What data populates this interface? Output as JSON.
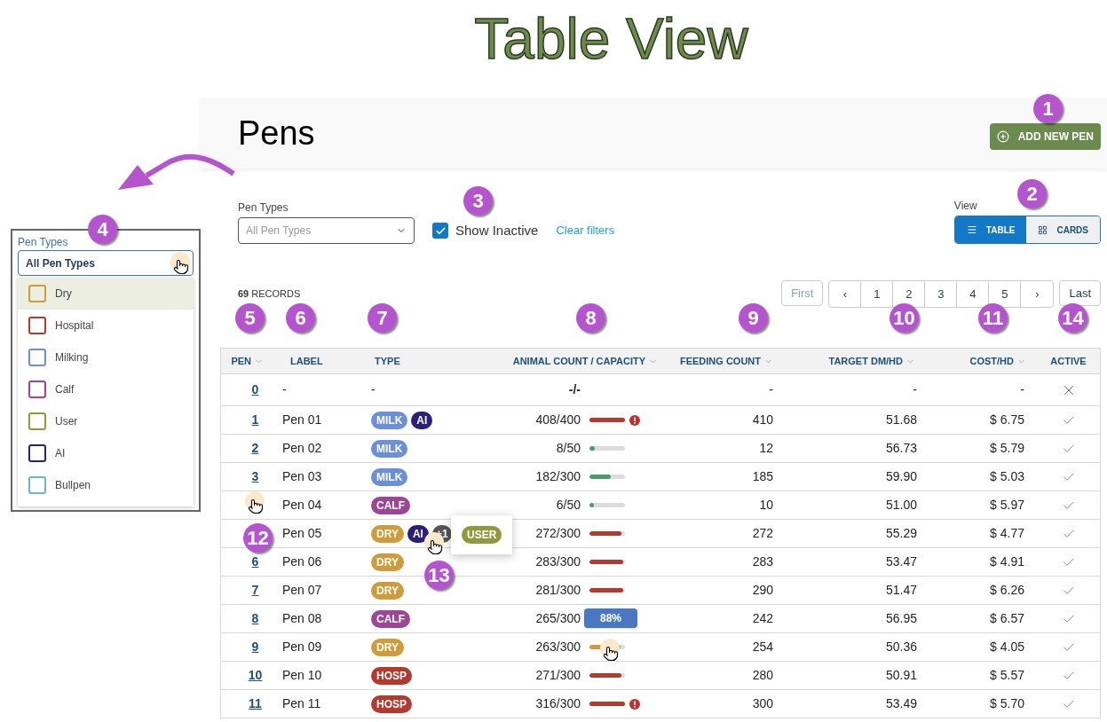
{
  "title": "Table View",
  "page": {
    "heading": "Pens",
    "add_button": "ADD NEW PEN"
  },
  "filters": {
    "label": "Pen Types",
    "placeholder": "All Pen Types",
    "show_inactive": {
      "label": "Show Inactive",
      "checked": true
    },
    "clear_link": "Clear filters"
  },
  "view": {
    "label": "View",
    "options": [
      {
        "label": "TABLE",
        "kind": "list",
        "selected": true
      },
      {
        "label": "CARDS",
        "kind": "grid",
        "selected": false
      }
    ]
  },
  "records": {
    "count": "69",
    "label": "RECORDS"
  },
  "pagination": [
    {
      "label": "First",
      "kind": "edge",
      "disabled": true
    },
    {
      "label": "‹",
      "kind": "page",
      "disabled": false
    },
    {
      "label": "1",
      "kind": "page",
      "disabled": false
    },
    {
      "label": "2",
      "kind": "page",
      "disabled": false
    },
    {
      "label": "3",
      "kind": "page",
      "disabled": false
    },
    {
      "label": "4",
      "kind": "page",
      "disabled": false
    },
    {
      "label": "5",
      "kind": "page",
      "disabled": false
    },
    {
      "label": "›",
      "kind": "page",
      "disabled": false
    },
    {
      "label": "Last",
      "kind": "edge",
      "disabled": false
    }
  ],
  "table": {
    "columns": [
      {
        "label": "PEN",
        "sortable": true
      },
      {
        "label": "LABEL",
        "sortable": false
      },
      {
        "label": "TYPE",
        "sortable": false
      },
      {
        "label": "ANIMAL COUNT / CAPACITY",
        "sortable": true
      },
      {
        "label": "FEEDING COUNT",
        "sortable": true
      },
      {
        "label": "TARGET DM/HD",
        "sortable": true
      },
      {
        "label": "COST/HD",
        "sortable": true
      },
      {
        "label": "ACTIVE",
        "sortable": false
      }
    ],
    "rows": [
      {
        "pen": "0",
        "label": "-",
        "type_text": "-",
        "capacity": {
          "reading": "-/-",
          "alert": false
        },
        "feeding": "-",
        "target": "-",
        "cost": "-",
        "active": false
      },
      {
        "pen": "1",
        "label": "Pen 01",
        "types": [
          {
            "text": "MILK",
            "color": "#6b8fd8",
            "kind": "tag"
          },
          {
            "text": "AI",
            "color": "#2b1f7a",
            "kind": "tag"
          }
        ],
        "capacity": {
          "reading": "408/400",
          "level": 1,
          "color": "#b23a2e",
          "alert": true
        },
        "feeding": "410",
        "target": "51.68",
        "cost": "$ 6.75",
        "active": true
      },
      {
        "pen": "2",
        "label": "Pen 02",
        "types": [
          {
            "text": "MILK",
            "color": "#6b8fd8",
            "kind": "tag"
          }
        ],
        "capacity": {
          "reading": "8/50",
          "level": 0.16,
          "color": "#4a9a6a",
          "alert": false
        },
        "feeding": "12",
        "target": "56.73",
        "cost": "$ 5.79",
        "active": true
      },
      {
        "pen": "3",
        "label": "Pen 03",
        "types": [
          {
            "text": "MILK",
            "color": "#6b8fd8",
            "kind": "tag"
          }
        ],
        "capacity": {
          "reading": "182/300",
          "level": 0.61,
          "color": "#4a9a6a",
          "alert": false
        },
        "feeding": "185",
        "target": "59.90",
        "cost": "$ 5.03",
        "active": true
      },
      {
        "label": "Pen 04",
        "types": [
          {
            "text": "CALF",
            "color": "#9b4795",
            "kind": "tag"
          }
        ],
        "capacity": {
          "reading": "6/50",
          "level": 0.12,
          "color": "#4a9a6a",
          "alert": false
        },
        "feeding": "10",
        "target": "51.00",
        "cost": "$ 5.97",
        "active": true
      },
      {
        "label": "Pen 05",
        "types": [
          {
            "text": "DRY",
            "color": "#d09b3a",
            "kind": "tag"
          },
          {
            "text": "AI",
            "color": "#2b1f7a",
            "kind": "tag"
          },
          {
            "text": "+1",
            "color": "#555555",
            "kind": "more",
            "popover": [
              {
                "text": "USER",
                "color": "#8f9a3c"
              }
            ]
          }
        ],
        "capacity": {
          "reading": "272/300",
          "level": 0.91,
          "color": "#b23a2e",
          "alert": false
        },
        "feeding": "272",
        "target": "55.29",
        "cost": "$ 4.77",
        "active": true
      },
      {
        "pen": "6",
        "label": "Pen 06",
        "types": [
          {
            "text": "DRY",
            "color": "#d09b3a",
            "kind": "tag"
          }
        ],
        "capacity": {
          "reading": "283/300",
          "level": 0.94,
          "color": "#b23a2e",
          "alert": false
        },
        "feeding": "283",
        "target": "53.47",
        "cost": "$ 4.91",
        "active": true
      },
      {
        "pen": "7",
        "label": "Pen 07",
        "types": [
          {
            "text": "DRY",
            "color": "#d09b3a",
            "kind": "tag"
          }
        ],
        "capacity": {
          "reading": "281/300",
          "level": 0.94,
          "color": "#b23a2e",
          "alert": false
        },
        "feeding": "290",
        "target": "51.47",
        "cost": "$ 6.26",
        "active": true
      },
      {
        "pen": "8",
        "label": "Pen 08",
        "types": [
          {
            "text": "CALF",
            "color": "#9b4795",
            "kind": "tag"
          }
        ],
        "capacity": {
          "reading": "265/300",
          "alert": false
        },
        "feeding": "242",
        "target": "56.95",
        "cost": "$ 6.57",
        "active": true
      },
      {
        "pen": "9",
        "label": "Pen 09",
        "types": [
          {
            "text": "DRY",
            "color": "#d09b3a",
            "kind": "tag"
          }
        ],
        "capacity": {
          "reading": "263/300",
          "level": 0.88,
          "color": "#d09b3a",
          "alert": false,
          "tooltip": "88%"
        },
        "feeding": "254",
        "target": "50.36",
        "cost": "$ 4.05",
        "active": true
      },
      {
        "pen": "10",
        "label": "Pen 10",
        "types": [
          {
            "text": "HOSP",
            "color": "#b23a2e",
            "kind": "tag"
          }
        ],
        "capacity": {
          "reading": "271/300",
          "level": 0.9,
          "color": "#b23a2e",
          "alert": false
        },
        "feeding": "280",
        "target": "50.91",
        "cost": "$ 5.57",
        "active": true
      },
      {
        "pen": "11",
        "label": "Pen 11",
        "types": [
          {
            "text": "HOSP",
            "color": "#b23a2e",
            "kind": "tag"
          }
        ],
        "capacity": {
          "reading": "316/300",
          "level": 1,
          "color": "#b23a2e",
          "alert": true
        },
        "feeding": "300",
        "target": "53.49",
        "cost": "$ 5.70",
        "active": true
      }
    ]
  },
  "inset": {
    "label": "Pen Types",
    "value": "All Pen Types",
    "options": [
      {
        "label": "Dry",
        "color": "#d09b3a",
        "highlighted": true
      },
      {
        "label": "Hospital",
        "color": "#b23a2e",
        "highlighted": false
      },
      {
        "label": "Milking",
        "color": "#6b8fd8",
        "highlighted": false
      },
      {
        "label": "Calf",
        "color": "#9b4795",
        "highlighted": false
      },
      {
        "label": "User",
        "color": "#8f9a3c",
        "highlighted": false
      },
      {
        "label": "AI",
        "color": "#2b1f7a",
        "highlighted": false
      },
      {
        "label": "Bullpen",
        "color": "#6fb5c4",
        "highlighted": false
      }
    ]
  },
  "callouts": [
    "1",
    "2",
    "3",
    "4",
    "5",
    "6",
    "7",
    "8",
    "9",
    "10",
    "11",
    "14",
    "12",
    "13"
  ]
}
